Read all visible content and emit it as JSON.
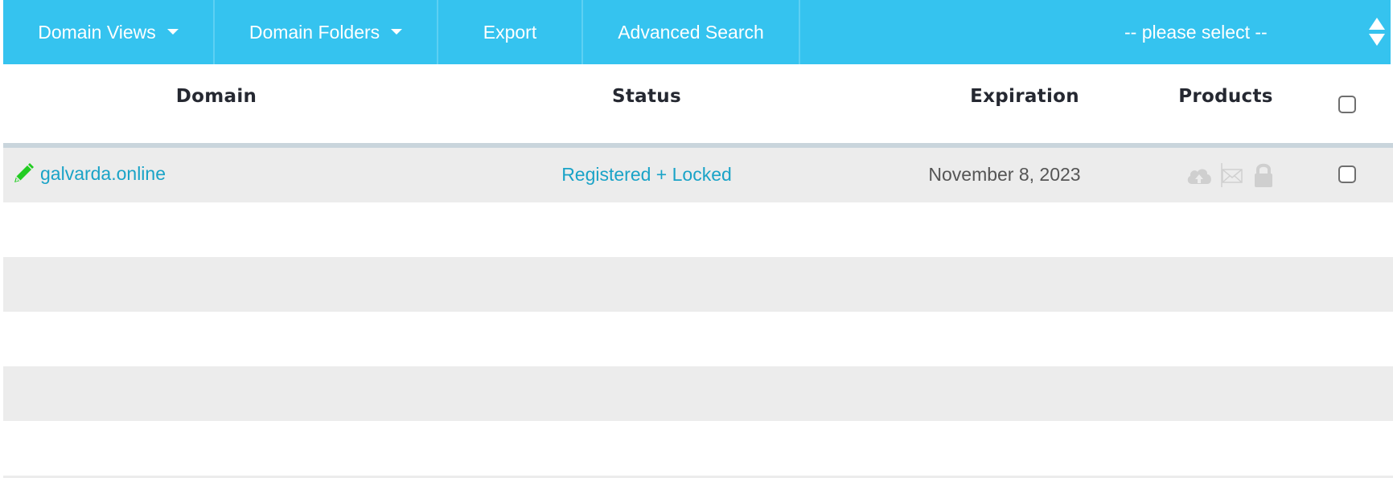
{
  "toolbar": {
    "domain_views": "Domain Views",
    "domain_folders": "Domain Folders",
    "export": "Export",
    "advanced_search": "Advanced Search",
    "select_placeholder": "-- please select --",
    "bg_color": "#35c3ef"
  },
  "table": {
    "headers": {
      "domain": "Domain",
      "status": "Status",
      "expiration": "Expiration",
      "products": "Products"
    },
    "rows": [
      {
        "domain": "galvarda.online",
        "status": "Registered + Locked",
        "expiration": "November 8, 2023",
        "products": [
          "cloud-upload-icon",
          "envelope-icon",
          "lock-icon"
        ],
        "checked": false
      }
    ],
    "link_color": "#1aa3c7",
    "edit_icon_color": "#22cc22"
  }
}
